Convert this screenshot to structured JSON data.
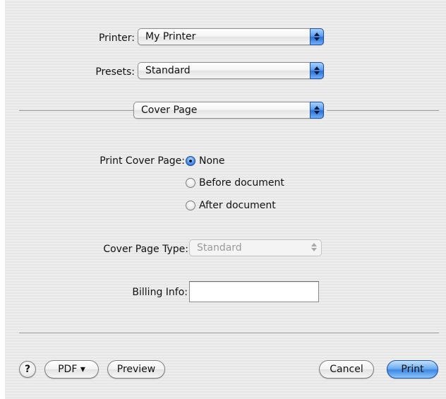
{
  "printer": {
    "label": "Printer:",
    "value": "My Printer"
  },
  "presets": {
    "label": "Presets:",
    "value": "Standard"
  },
  "panel_selector": {
    "value": "Cover Page"
  },
  "cover_page": {
    "label": "Print Cover Page:",
    "options": [
      {
        "label": "None",
        "selected": true
      },
      {
        "label": "Before document",
        "selected": false
      },
      {
        "label": "After document",
        "selected": false
      }
    ]
  },
  "cover_page_type": {
    "label": "Cover Page Type:",
    "value": "Standard",
    "enabled": false
  },
  "billing_info": {
    "label": "Billing Info:",
    "value": ""
  },
  "buttons": {
    "help": "?",
    "pdf": "PDF ▾",
    "preview": "Preview",
    "cancel": "Cancel",
    "print": "Print"
  },
  "icons": {
    "popup_arrows": "up-down-arrows-icon",
    "radio_selected": "radio-dot-icon",
    "help": "question-mark-icon"
  },
  "colors": {
    "accent_blue": "#4f92ea",
    "background": "#ececec"
  }
}
